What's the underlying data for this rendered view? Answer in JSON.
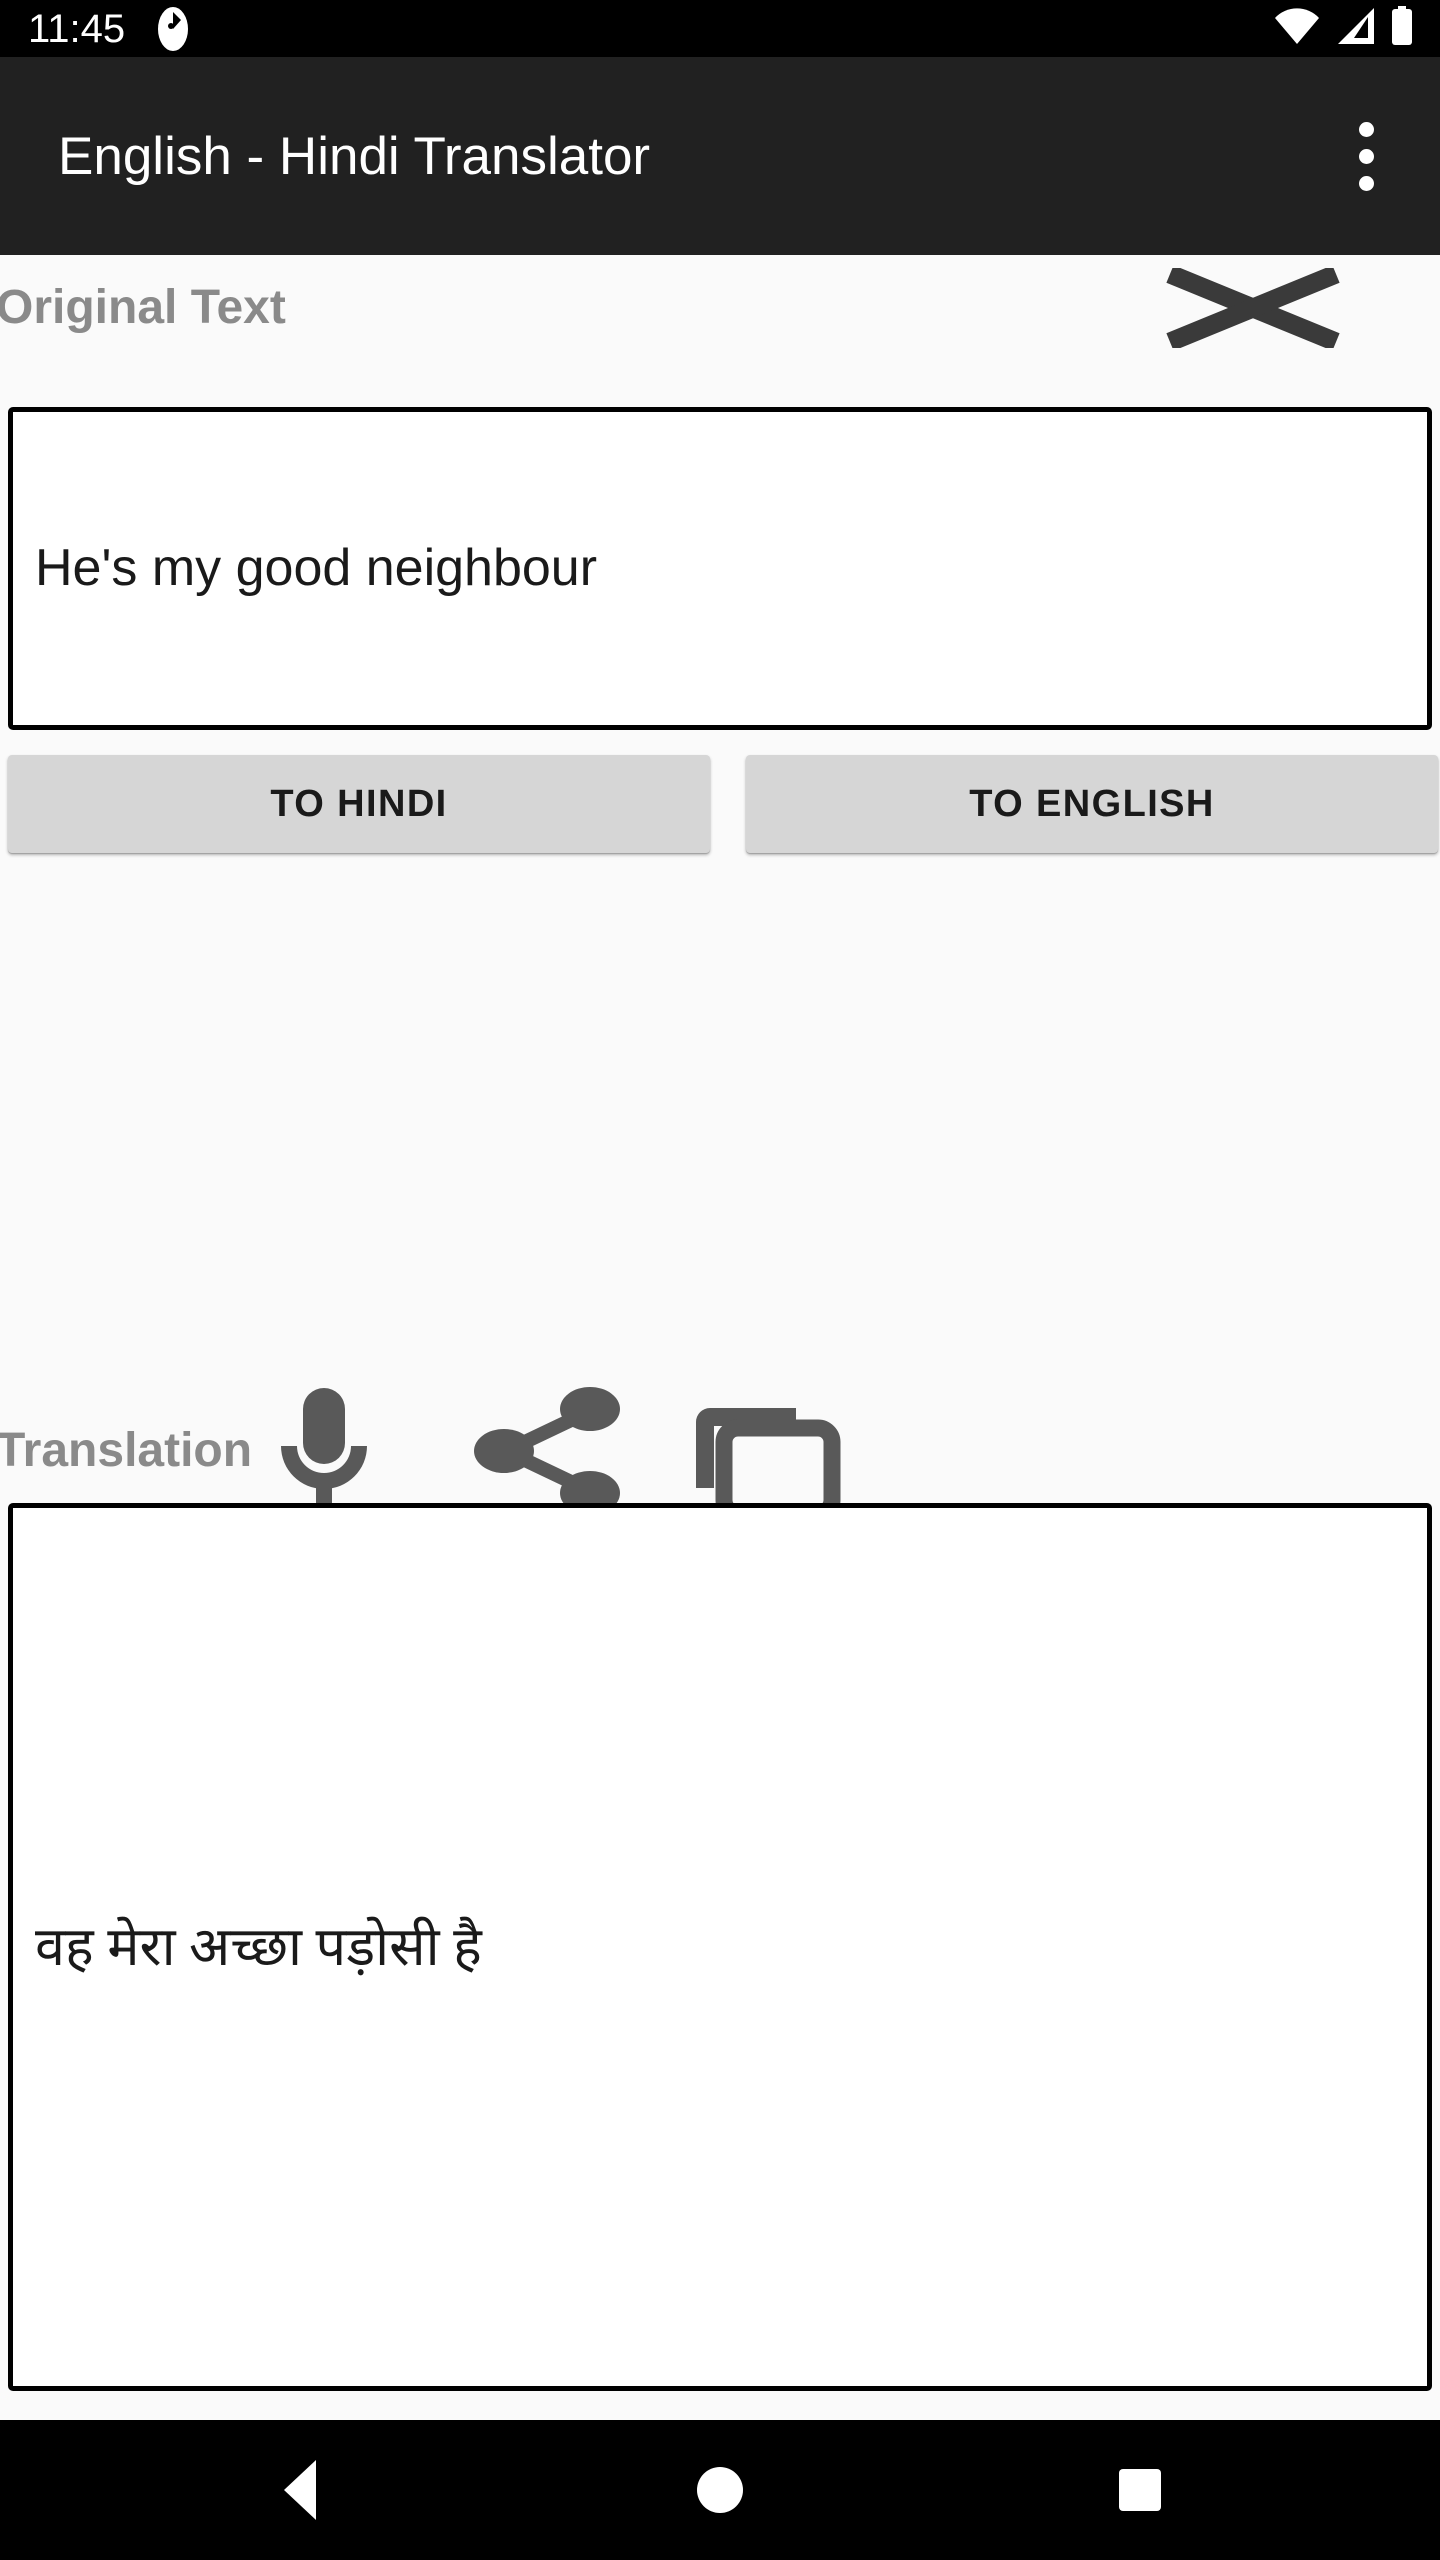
{
  "status_bar": {
    "clock": "11:45",
    "left_icons": [
      "app-notification-icon"
    ],
    "right_icons": [
      "wifi-icon",
      "cellular-signal-off-icon",
      "battery-full-icon"
    ],
    "background": "#000000",
    "foreground": "#ffffff"
  },
  "app_bar": {
    "title": "English - Hindi Translator",
    "overflow_menu": "more-options",
    "background": "#212121",
    "title_color": "#ffffff"
  },
  "original_section": {
    "label": "Original Text",
    "clear_icon": "clear-x-icon",
    "input_value": "He's my good neighbour",
    "input_placeholder": ""
  },
  "actions": {
    "to_hindi_label": "TO HINDI",
    "to_english_label": "TO ENGLISH",
    "button_background": "#d6d6d6",
    "button_text_color": "#1a1a1a"
  },
  "translation_section": {
    "label": "Translation",
    "icons": [
      "microphone-icon",
      "share-icon",
      "copy-icon"
    ],
    "output_value": "वह मेरा अच्छा पड़ोसी है"
  },
  "nav_bar": {
    "buttons": [
      "back-button",
      "home-button",
      "recents-button"
    ],
    "background": "#000000"
  },
  "theme": {
    "label_gray": "#8a8a8a",
    "icon_gray": "#595959",
    "page_background": "#fafafa",
    "box_border": "#000000"
  }
}
